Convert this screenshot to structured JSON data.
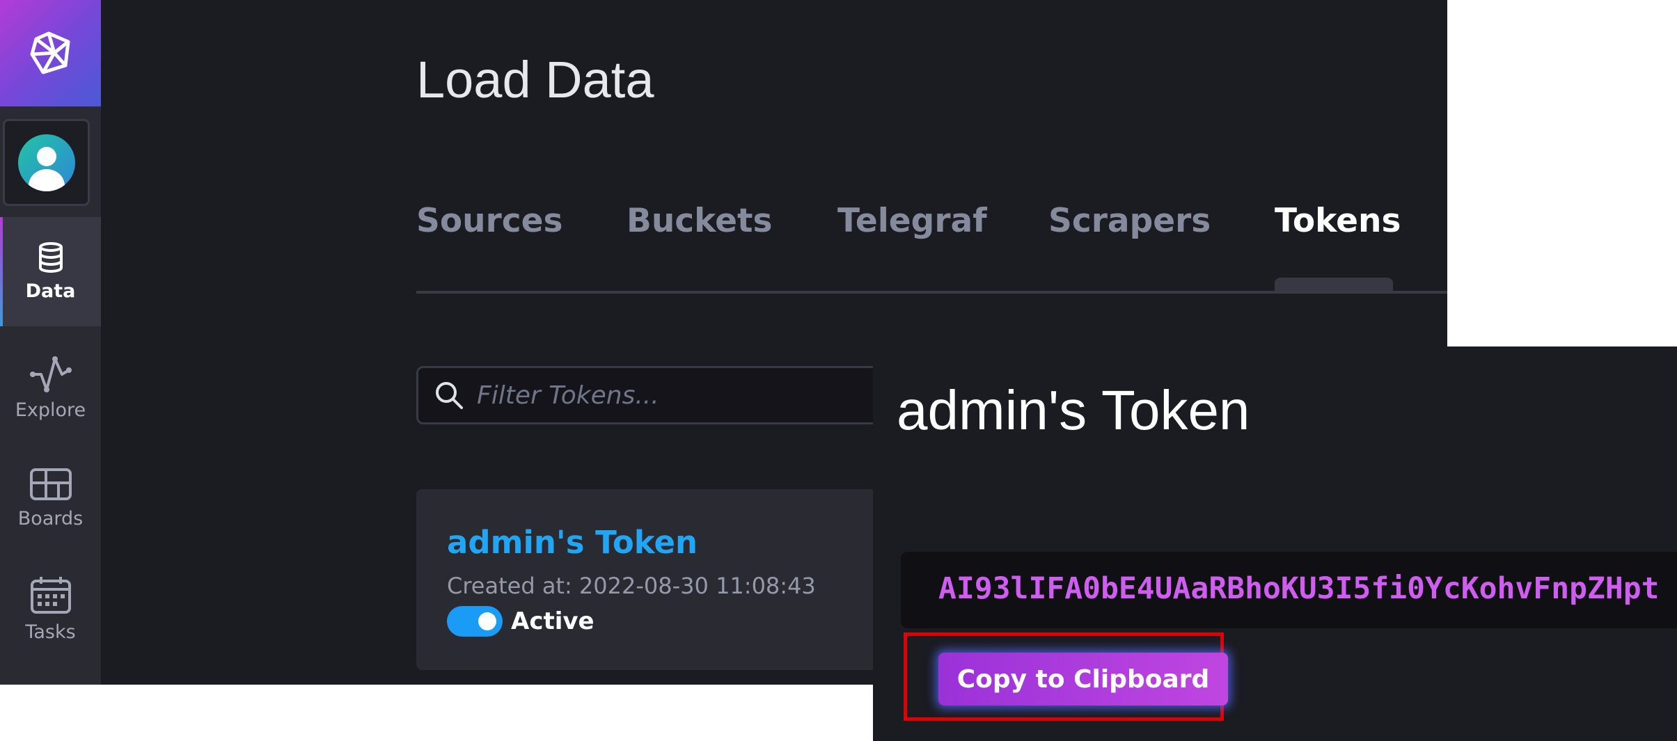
{
  "sidebar": {
    "logo_icon": "influxdb-logo-icon",
    "avatar_icon": "user-avatar-icon",
    "items": [
      {
        "label": "Data",
        "icon": "database-icon",
        "active": true
      },
      {
        "label": "Explore",
        "icon": "graph-line-icon",
        "active": false
      },
      {
        "label": "Boards",
        "icon": "dashboard-grid-icon",
        "active": false
      },
      {
        "label": "Tasks",
        "icon": "calendar-icon",
        "active": false
      }
    ]
  },
  "page": {
    "title": "Load Data",
    "tabs": [
      {
        "label": "Sources",
        "active": false
      },
      {
        "label": "Buckets",
        "active": false
      },
      {
        "label": "Telegraf",
        "active": false
      },
      {
        "label": "Scrapers",
        "active": false
      },
      {
        "label": "Tokens",
        "active": true
      }
    ],
    "filter": {
      "placeholder": "Filter Tokens...",
      "value": ""
    },
    "token_card": {
      "name": "admin's Token",
      "created": "Created at: 2022-08-30 11:08:43",
      "status": "Active"
    }
  },
  "modal": {
    "title": "admin's Token",
    "token_value": "AI93lIFA0bE4UAaRBhoKU3I5fi0YcKohvFnpZHpt",
    "copy_label": "Copy to Clipboard"
  },
  "colors": {
    "accent_blue": "#21a5f5",
    "accent_purple": "#c046e0",
    "highlight_red": "#e00000",
    "background": "#1b1b22"
  }
}
